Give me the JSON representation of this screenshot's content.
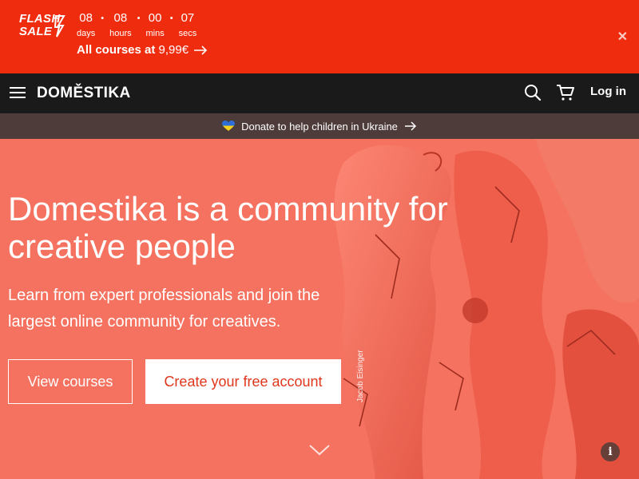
{
  "flash_sale": {
    "logo_line1": "FLASH",
    "logo_line2": "SALE",
    "countdown": [
      {
        "value": "08",
        "label": "days"
      },
      {
        "value": "08",
        "label": "hours"
      },
      {
        "value": "00",
        "label": "mins"
      },
      {
        "value": "07",
        "label": "secs"
      }
    ],
    "separator": "•",
    "offer_prefix": "All courses at",
    "offer_price": "9,99€",
    "close_symbol": "✕"
  },
  "nav": {
    "logo": "DOMĚSTIKA",
    "login_label": "Log in"
  },
  "ukraine_bar": {
    "text": "Donate to help children in Ukraine",
    "colors": {
      "blue": "#2d6fd6",
      "yellow": "#f7d21c"
    }
  },
  "hero": {
    "title": "Domestika is a community for creative people",
    "subtitle": "Learn from expert professionals and join the largest online community for creatives.",
    "view_courses_label": "View courses",
    "create_account_label": "Create your free account",
    "image_credit": "Jacob Eisinger",
    "info_symbol": "i"
  },
  "colors": {
    "flash_bg": "#ef2d0e",
    "nav_bg": "#1a1a1a",
    "hero_bg": "#f4725f",
    "accent": "#e0361b"
  },
  "icons": [
    "hamburger-icon",
    "search-icon",
    "cart-icon",
    "arrow-right-icon",
    "heart-icon",
    "chevron-down-icon",
    "info-icon",
    "close-icon",
    "lightning-icon"
  ]
}
